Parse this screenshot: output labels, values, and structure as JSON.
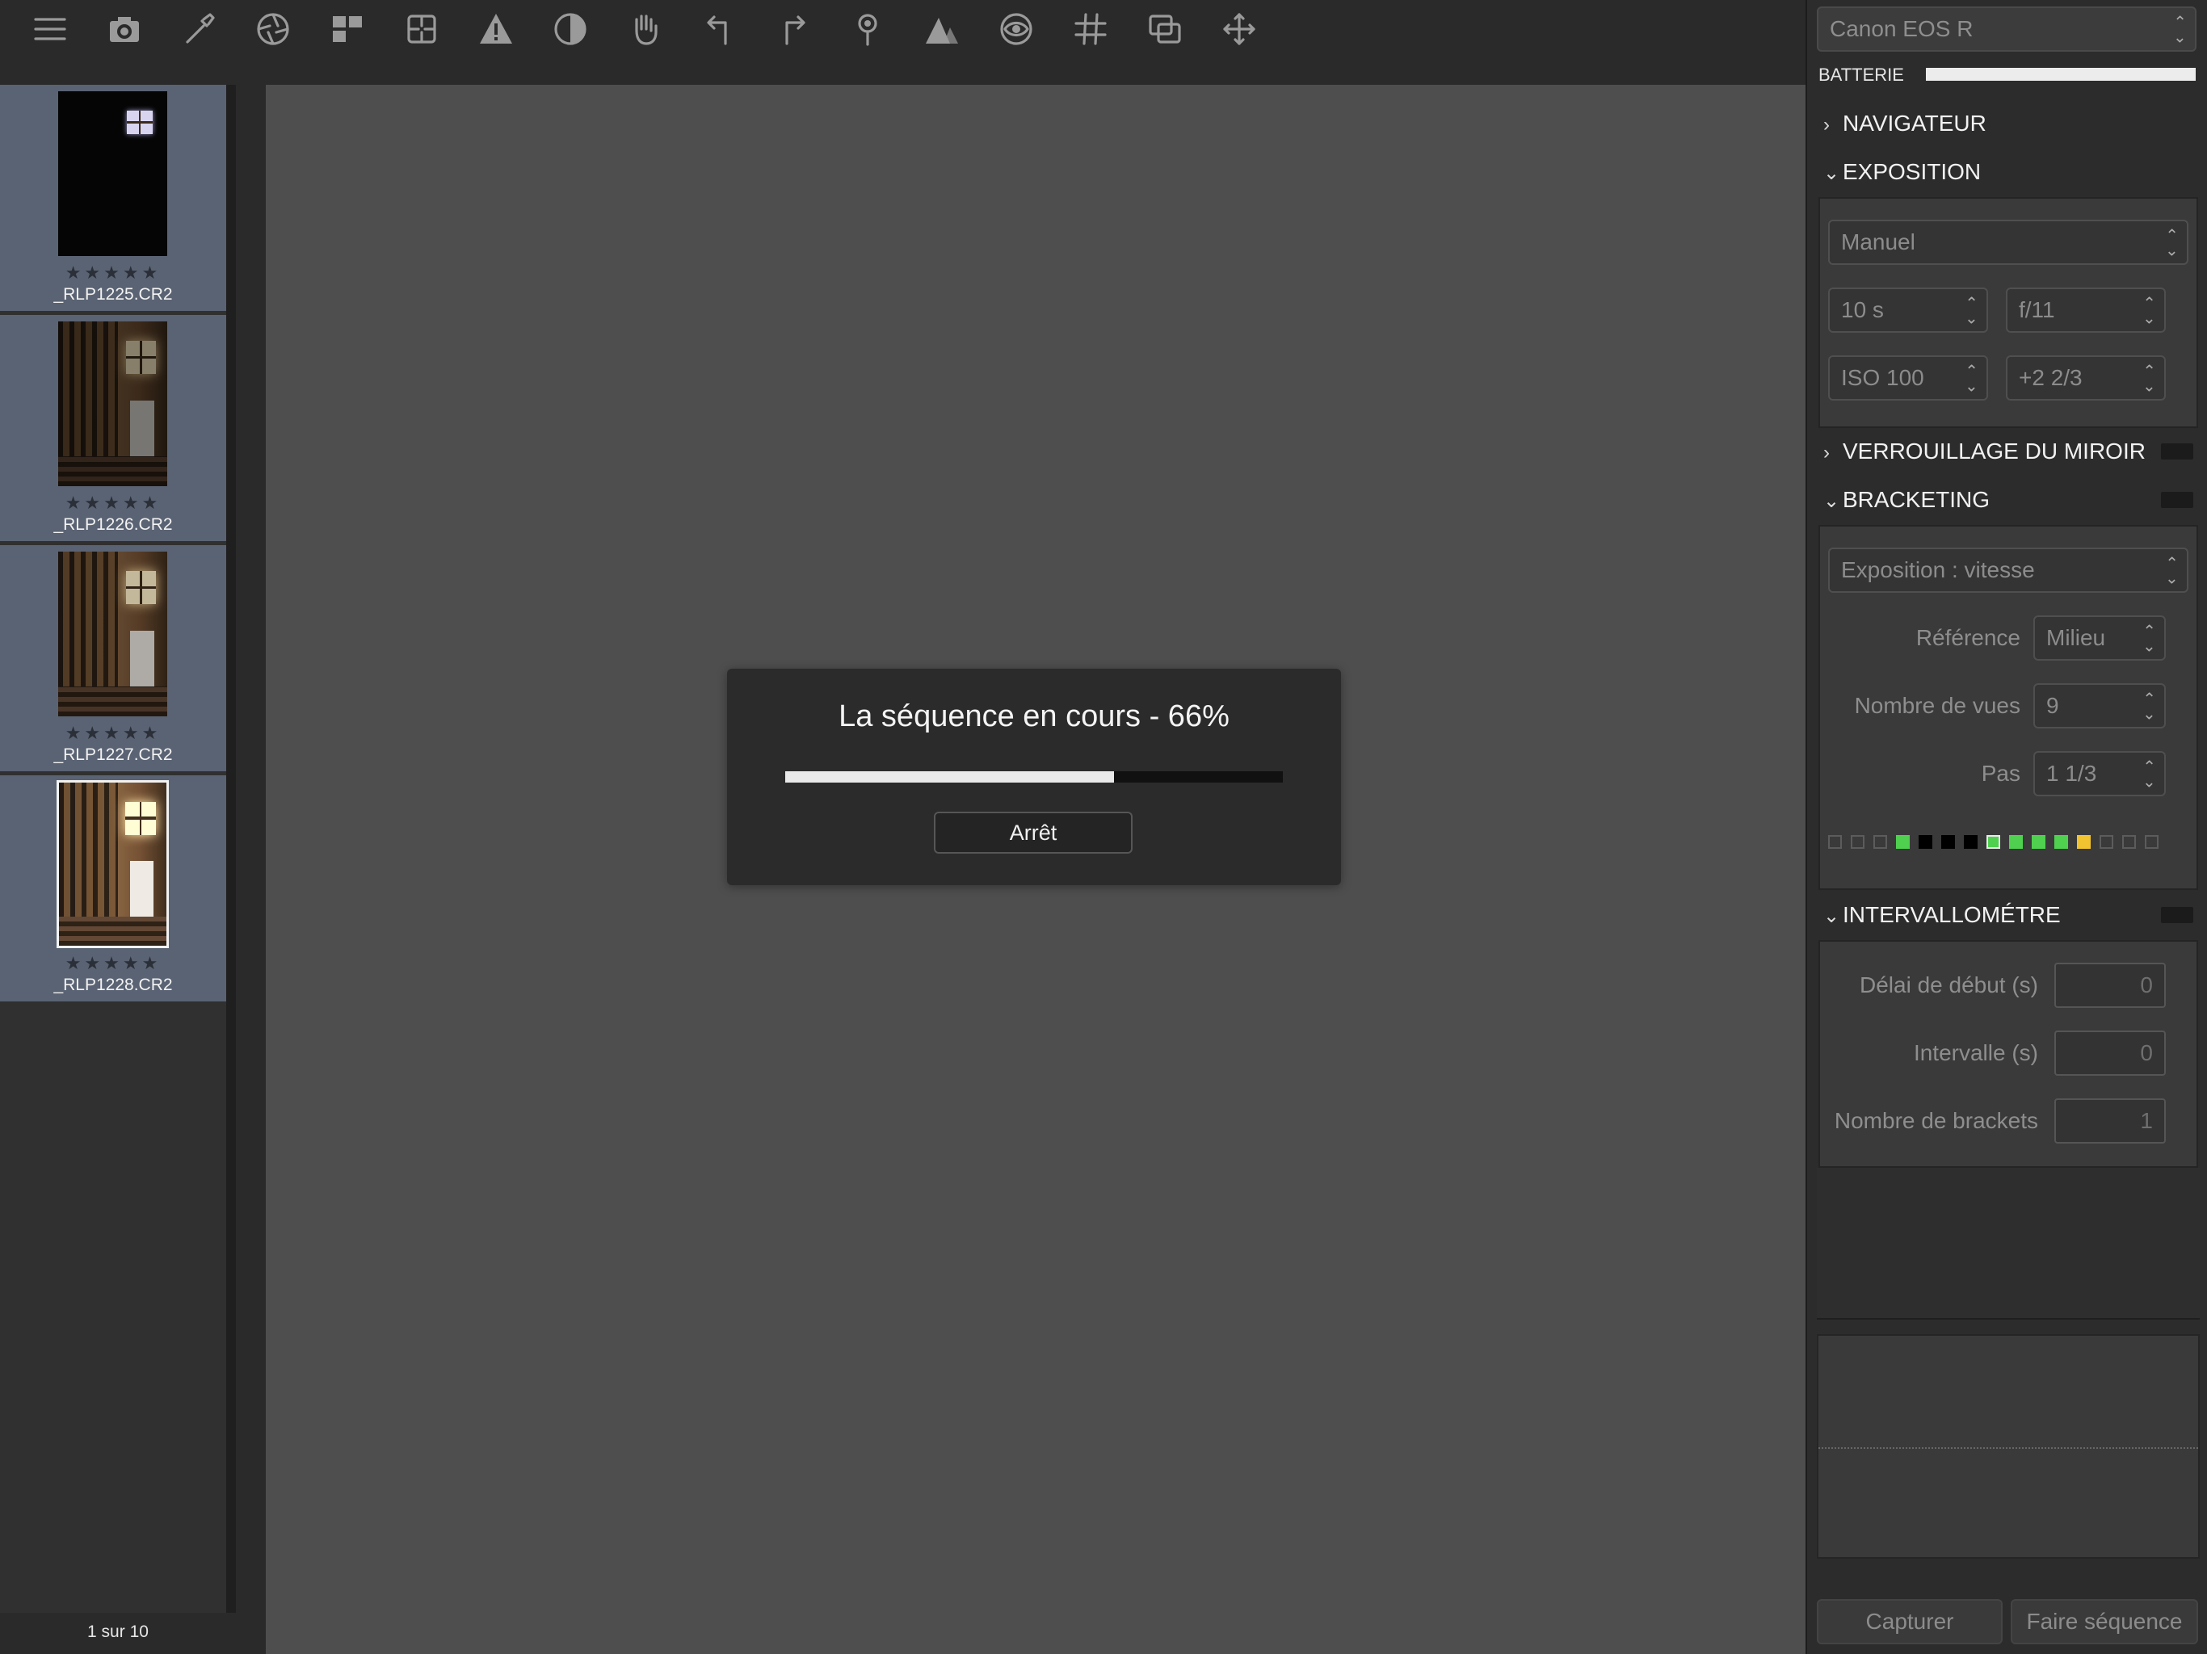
{
  "toolbar": {
    "tools": [
      "menu-icon",
      "camera-icon",
      "eyedropper-icon",
      "aperture-icon",
      "layout-icon",
      "crop-icon",
      "warning-icon",
      "contrast-icon",
      "hand-icon",
      "rotate-left-icon",
      "rotate-right-icon",
      "pin-icon",
      "mountains-icon",
      "eye-icon",
      "grid-icon",
      "overlay-icon",
      "move-icon"
    ]
  },
  "filmstrip": {
    "items": [
      {
        "name": "_RLP1225.CR2",
        "stars": "★★★★★",
        "selected": false
      },
      {
        "name": "_RLP1226.CR2",
        "stars": "★★★★★",
        "selected": false
      },
      {
        "name": "_RLP1227.CR2",
        "stars": "★★★★★",
        "selected": false
      },
      {
        "name": "_RLP1228.CR2",
        "stars": "★★★★★",
        "selected": true
      }
    ],
    "counter": "1 sur 10"
  },
  "dialog": {
    "title": "La séquence en cours - 66%",
    "progress": 0.66,
    "stop_label": "Arrêt"
  },
  "panel": {
    "camera": "Canon EOS R",
    "battery_label": "BATTERIE",
    "battery_level": 1.0,
    "sections": {
      "navigator": {
        "label": "NAVIGATEUR",
        "expanded": false
      },
      "exposure": {
        "label": "EXPOSITION",
        "expanded": true,
        "mode": "Manuel",
        "shutter": "10 s",
        "aperture": "f/11",
        "iso": "ISO 100",
        "compensation": "+2 2/3"
      },
      "mirror_lock": {
        "label": "VERROUILLAGE DU MIROIR",
        "expanded": false
      },
      "bracketing": {
        "label": "BRACKETING",
        "expanded": true,
        "type": "Exposition : vitesse",
        "reference_label": "Référence",
        "reference_value": "Milieu",
        "shots_label": "Nombre de vues",
        "shots_value": "9",
        "step_label": "Pas",
        "step_value": "1 1/3",
        "indicators": [
          "empty",
          "empty",
          "empty",
          "green",
          "black",
          "black",
          "black",
          "green-outline",
          "green",
          "green",
          "green",
          "yellow",
          "empty",
          "empty",
          "empty"
        ]
      },
      "intervalometer": {
        "label": "INTERVALLOMÉTRE",
        "expanded": true,
        "start_delay_label": "Délai de début (s)",
        "start_delay_value": "0",
        "interval_label": "Intervalle (s)",
        "interval_value": "0",
        "brackets_label": "Nombre de brackets",
        "brackets_value": "1"
      }
    },
    "capture_label": "Capturer",
    "sequence_label": "Faire séquence"
  },
  "colors": {
    "green": "#4fd14f",
    "yellow": "#f2c330",
    "thumb_bg": "#5a6373"
  }
}
